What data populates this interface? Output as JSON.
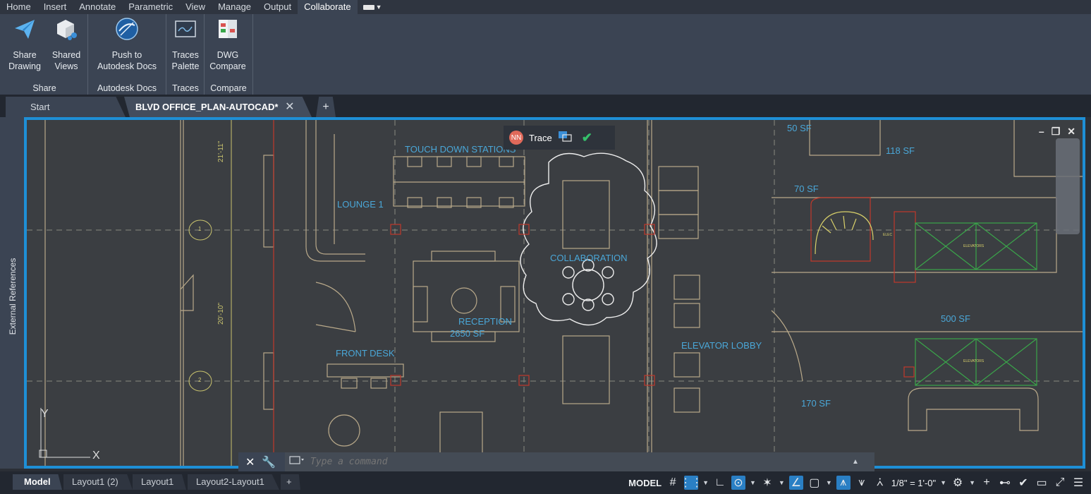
{
  "menu": {
    "items": [
      "Home",
      "Insert",
      "Annotate",
      "Parametric",
      "View",
      "Manage",
      "Output",
      "Collaborate"
    ],
    "active": "Collaborate"
  },
  "ribbon": {
    "buttons": {
      "share_drawing": [
        "Share",
        "Drawing"
      ],
      "shared_views": [
        "Shared",
        "Views"
      ],
      "push_docs": [
        "Push to",
        "Autodesk Docs"
      ],
      "traces_palette": [
        "Traces",
        "Palette"
      ],
      "dwg_compare": [
        "DWG",
        "Compare"
      ]
    },
    "groups": {
      "share": "Share",
      "docs": "Autodesk Docs",
      "traces": "Traces",
      "compare": "Compare"
    }
  },
  "tabs": {
    "start": "Start",
    "active": "BLVD OFFICE_PLAN-AUTOCAD*",
    "close": "✕",
    "plus": "+"
  },
  "side_panel": {
    "label": "External References"
  },
  "drawing": {
    "labels": {
      "touch_down": "TOUCH DOWN STATIONS",
      "lounge": "LOUNGE 1",
      "collaboration": "COLLABORATION",
      "reception": "RECEPTION",
      "reception_area": "2650 SF",
      "front_desk": "FRONT DESK",
      "elevator_lobby": "ELEVATOR LOBBY",
      "sf_50": "50 SF",
      "sf_118": "118 SF",
      "sf_70": "70 SF",
      "sf_500": "500 SF",
      "sf_170": "170 SF",
      "dim1": "21'-11\"",
      "dim2": "20'-10\"",
      "grid1": "1",
      "grid2": "2",
      "elevators": "ELEVATORS",
      "elec": "ELEC",
      "axis_y": "Y"
    }
  },
  "trace": {
    "initials": "NN",
    "label": "Trace"
  },
  "command": {
    "placeholder": "Type a command"
  },
  "layout_tabs": [
    "Model",
    "Layout1 (2)",
    "Layout1",
    "Layout2-Layout1"
  ],
  "status": {
    "model": "MODEL",
    "scale": "1/8\" = 1'-0\""
  },
  "colors": {
    "accent": "#1e8fd6",
    "label": "#4aa7d8",
    "wall": "#b9a98a",
    "wall_red": "#c0392b",
    "green": "#3aa64a"
  }
}
